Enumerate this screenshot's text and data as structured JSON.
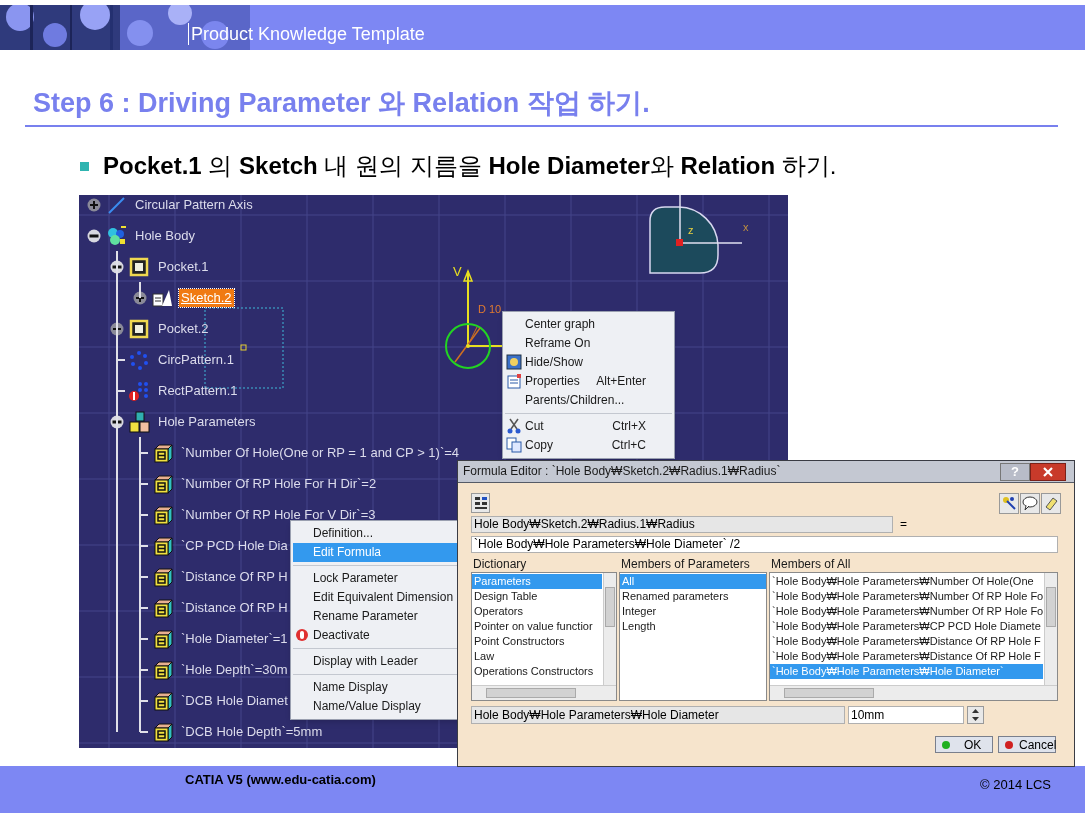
{
  "header": {
    "title": "Product Knowledge Template"
  },
  "heading": "Step 6 : Driving Parameter 와 Relation 작업 하기.",
  "bullet": "**Pocket.1** 의 **Sketch** 내 원의 지름을 **Hole Diameter**와 **Relation** 하기.",
  "viewer": {
    "tree": [
      {
        "label": "Circular Pattern Axis",
        "kind": "axis",
        "expanded": false,
        "selected": false
      },
      {
        "label": "Hole Body",
        "kind": "body",
        "expanded": true,
        "selected": false,
        "children": [
          {
            "label": "Pocket.1",
            "kind": "pocket",
            "expanded": true,
            "selected": false,
            "children": [
              {
                "label": "Sketch.2",
                "kind": "sketch",
                "expanded": false,
                "selected": true
              }
            ]
          },
          {
            "label": "Pocket.2",
            "kind": "pocket",
            "expanded": false,
            "selected": false
          },
          {
            "label": "CircPattern.1",
            "kind": "circ-pattern",
            "selected": false
          },
          {
            "label": "RectPattern.1",
            "kind": "rect-pattern",
            "selected": false
          },
          {
            "label": "Hole Parameters",
            "kind": "parameter-set",
            "expanded": true,
            "selected": false,
            "children": [
              {
                "label": "`Number Of Hole(One or RP = 1 and CP > 1)`=4",
                "kind": "parameter",
                "selected": false
              },
              {
                "label": "`Number Of RP Hole For H Dir`=2",
                "kind": "parameter",
                "selected": false
              },
              {
                "label": "`Number Of RP Hole For V Dir`=3",
                "kind": "parameter",
                "selected": false
              },
              {
                "label": "`CP PCD Hole Dia",
                "kind": "parameter",
                "selected": false
              },
              {
                "label": "`Distance Of RP H",
                "kind": "parameter",
                "selected": false
              },
              {
                "label": "`Distance Of RP H",
                "kind": "parameter",
                "selected": false
              },
              {
                "label": "`Hole Diameter`=1",
                "kind": "parameter",
                "selected": false
              },
              {
                "label": "`Hole Depth`=30m",
                "kind": "parameter",
                "selected": false
              },
              {
                "label": "`DCB Hole Diamet",
                "kind": "parameter",
                "selected": false
              },
              {
                "label": "`DCB Hole Depth`=5mm",
                "kind": "parameter",
                "selected": false
              }
            ]
          }
        ]
      }
    ],
    "axis_label": "V",
    "dimension_label": "D 10",
    "compass_labels": [
      "z",
      "x"
    ],
    "graph_menu": [
      {
        "kind": "item",
        "label": "Center graph",
        "selected": false
      },
      {
        "kind": "item",
        "label": "Reframe On",
        "selected": false
      },
      {
        "kind": "item",
        "label": "Hide/Show",
        "selected": false
      },
      {
        "kind": "item",
        "label": "Properties",
        "shortcut": "Alt+Enter",
        "selected": false
      },
      {
        "kind": "item",
        "label": "Parents/Children...",
        "selected": false
      },
      {
        "kind": "separator"
      },
      {
        "kind": "item",
        "label": "Cut",
        "shortcut": "Ctrl+X",
        "selected": false
      },
      {
        "kind": "item",
        "label": "Copy",
        "shortcut": "Ctrl+C",
        "selected": false
      }
    ],
    "parameter_menu": [
      {
        "kind": "item",
        "label": "Definition...",
        "selected": false
      },
      {
        "kind": "item",
        "label": "Edit Formula",
        "selected": true
      },
      {
        "kind": "separator"
      },
      {
        "kind": "item",
        "label": "Lock Parameter",
        "selected": false
      },
      {
        "kind": "item",
        "label": "Edit Equivalent Dimension",
        "selected": false
      },
      {
        "kind": "item",
        "label": "Rename Parameter",
        "selected": false
      },
      {
        "kind": "item",
        "label": "Deactivate",
        "selected": false
      },
      {
        "kind": "separator"
      },
      {
        "kind": "item",
        "label": "Display with Leader",
        "selected": false
      },
      {
        "kind": "separator"
      },
      {
        "kind": "item",
        "label": "Name Display",
        "selected": false
      },
      {
        "kind": "item",
        "label": "Name/Value Display",
        "selected": false
      }
    ]
  },
  "dialog": {
    "title": "Formula Editor : `Hole Body₩Sketch.2₩Radius.1₩Radius`",
    "help_button": "?",
    "parameter": "Hole Body₩Sketch.2₩Radius.1₩Radius",
    "equals": "=",
    "formula": "`Hole Body₩Hole Parameters₩Hole Diameter` /2",
    "lists": [
      {
        "title": "Dictionary",
        "items": [
          {
            "label": "Parameters",
            "selected": true
          },
          {
            "label": "Design Table",
            "selected": false
          },
          {
            "label": "Operators",
            "selected": false
          },
          {
            "label": "Pointer on value functior",
            "selected": false
          },
          {
            "label": "Point Constructors",
            "selected": false
          },
          {
            "label": "Law",
            "selected": false
          },
          {
            "label": "Operations Constructors",
            "selected": false
          }
        ]
      },
      {
        "title": "Members of Parameters",
        "items": [
          {
            "label": "All",
            "selected": true
          },
          {
            "label": "Renamed parameters",
            "selected": false
          },
          {
            "label": "Integer",
            "selected": false
          },
          {
            "label": "Length",
            "selected": false
          }
        ]
      },
      {
        "title": "Members of All",
        "items": [
          {
            "label": "`Hole Body₩Hole Parameters₩Number Of Hole(One",
            "selected": false
          },
          {
            "label": "`Hole Body₩Hole Parameters₩Number Of RP Hole Fo",
            "selected": false
          },
          {
            "label": "`Hole Body₩Hole Parameters₩Number Of RP Hole Fo",
            "selected": false
          },
          {
            "label": "`Hole Body₩Hole Parameters₩CP PCD Hole Diamete",
            "selected": false
          },
          {
            "label": "`Hole Body₩Hole Parameters₩Distance Of RP Hole F",
            "selected": false
          },
          {
            "label": "`Hole Body₩Hole Parameters₩Distance Of RP Hole F",
            "selected": false
          },
          {
            "label": "`Hole Body₩Hole Parameters₩Hole Diameter`",
            "selected": true
          }
        ]
      }
    ],
    "selected_path": "Hole Body₩Hole Parameters₩Hole Diameter",
    "value": "10mm",
    "buttons": [
      {
        "kind": "ok",
        "label": "OK"
      },
      {
        "kind": "cancel",
        "label": "Cancel"
      }
    ]
  },
  "footer": {
    "left": "CATIA V5 (www.edu-catia.com)",
    "right": "© 2014 LCS"
  }
}
